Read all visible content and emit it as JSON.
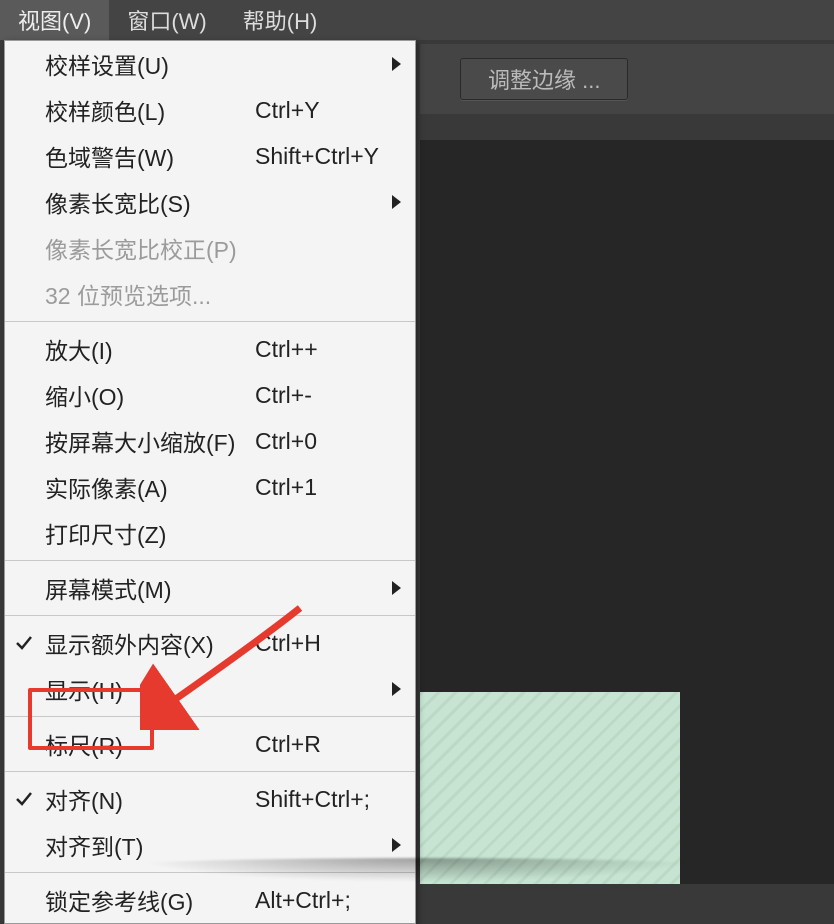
{
  "menubar": {
    "view": "视图(V)",
    "window": "窗口(W)",
    "help": "帮助(H)"
  },
  "optionsbar": {
    "refine_edge": "调整边缘 ..."
  },
  "menu": {
    "proof_setup": {
      "label": "校样设置(U)"
    },
    "proof_colors": {
      "label": "校样颜色(L)",
      "shortcut": "Ctrl+Y"
    },
    "gamut_warning": {
      "label": "色域警告(W)",
      "shortcut": "Shift+Ctrl+Y"
    },
    "pixel_aspect_ratio": {
      "label": "像素长宽比(S)"
    },
    "pixel_aspect_correction": {
      "label": "像素长宽比校正(P)"
    },
    "bit32_preview": {
      "label": "32 位预览选项..."
    },
    "zoom_in": {
      "label": "放大(I)",
      "shortcut": "Ctrl++"
    },
    "zoom_out": {
      "label": "缩小(O)",
      "shortcut": "Ctrl+-"
    },
    "fit_screen": {
      "label": "按屏幕大小缩放(F)",
      "shortcut": "Ctrl+0"
    },
    "actual_pixels": {
      "label": "实际像素(A)",
      "shortcut": "Ctrl+1"
    },
    "print_size": {
      "label": "打印尺寸(Z)"
    },
    "screen_mode": {
      "label": "屏幕模式(M)"
    },
    "extras": {
      "label": "显示额外内容(X)",
      "shortcut": "Ctrl+H"
    },
    "show": {
      "label": "显示(H)"
    },
    "rulers": {
      "label": "标尺(R)",
      "shortcut": "Ctrl+R"
    },
    "snap": {
      "label": "对齐(N)",
      "shortcut": "Shift+Ctrl+;"
    },
    "snap_to": {
      "label": "对齐到(T)"
    },
    "lock_guides": {
      "label": "锁定参考线(G)",
      "shortcut": "Alt+Ctrl+;"
    }
  }
}
